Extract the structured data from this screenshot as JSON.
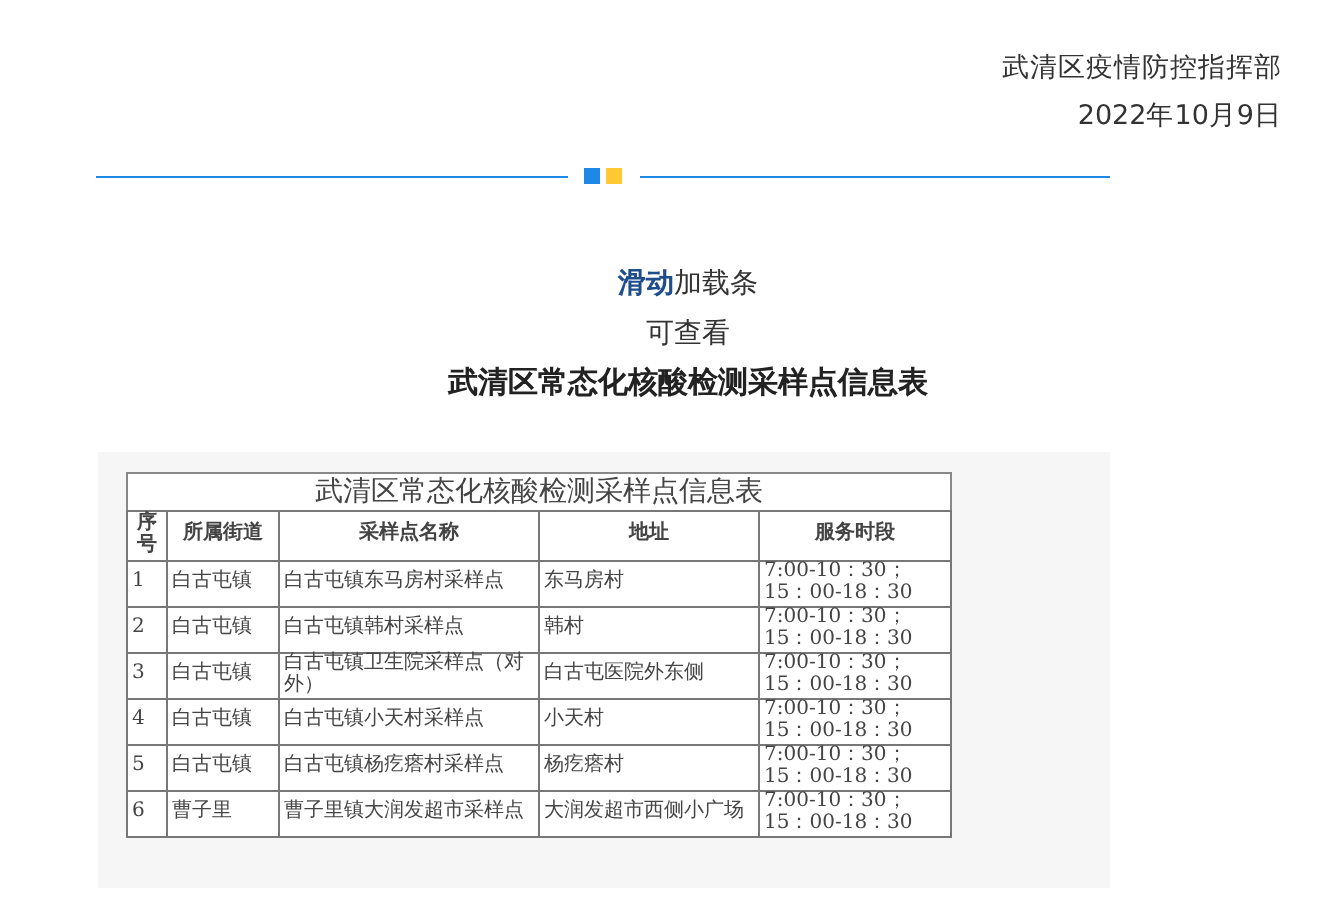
{
  "header": {
    "organization": "武清区疫情防控指挥部",
    "date": "2022年10月9日"
  },
  "intro": {
    "lines": [
      "**滑动**加载条",
      "可查看"
    ],
    "title": "武清区常态化核酸检测采样点信息表"
  },
  "table": {
    "title": "武清区常态化核酸检测采样点信息表",
    "columns": [
      "序号",
      "所属街道",
      "采样点名称",
      "地址",
      "服务时段"
    ],
    "rows": [
      [
        "1",
        "白古屯镇",
        "白古屯镇东马房村采样点",
        "东马房村",
        "7:00-10：30；15：00-18：30"
      ],
      [
        "2",
        "白古屯镇",
        "白古屯镇韩村采样点",
        "韩村",
        "7:00-10：30；15：00-18：30"
      ],
      [
        "3",
        "白古屯镇",
        "白古屯镇卫生院采样点（对外）",
        "白古屯医院外东侧",
        "7:00-10：30；15：00-18：30"
      ],
      [
        "4",
        "白古屯镇",
        "白古屯镇小天村采样点",
        "小天村",
        "7:00-10：30；15：00-18：30"
      ],
      [
        "5",
        "白古屯镇",
        "白古屯镇杨疙瘩村采样点",
        "杨疙瘩村",
        "7:00-10：30；15：00-18：30"
      ],
      [
        "6",
        "曹子里",
        "曹子里镇大润发超市采样点",
        "大润发超市西侧小广场",
        "7:00-10：30；15：00-18：30"
      ]
    ]
  }
}
